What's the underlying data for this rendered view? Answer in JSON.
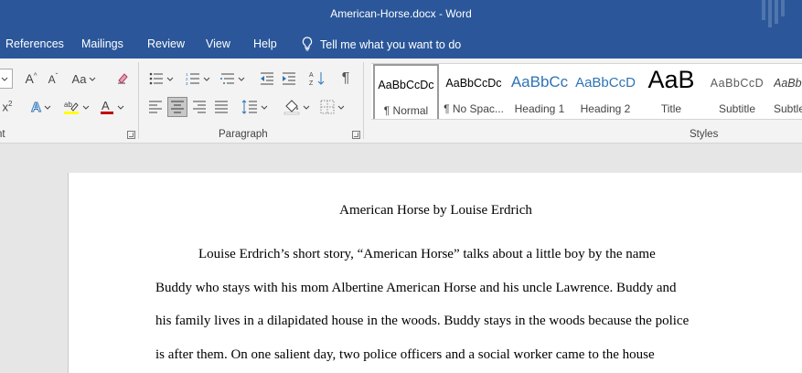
{
  "titlebar": {
    "title": "American-Horse.docx  -  Word"
  },
  "menu": {
    "tabs": [
      "References",
      "Mailings",
      "Review",
      "View",
      "Help"
    ],
    "tell_me": "Tell me what you want to do"
  },
  "ribbon": {
    "font_group_label": "nt",
    "paragraph_group_label": "Paragraph",
    "styles_group_label": "Styles",
    "change_case_label": "Aa",
    "styles": [
      {
        "preview": "AaBbCcDc",
        "name": "¶ Normal",
        "color": "#000000"
      },
      {
        "preview": "AaBbCcDc",
        "name": "¶ No Spac...",
        "color": "#000000"
      },
      {
        "preview": "AaBbCc",
        "name": "Heading 1",
        "color": "#2e74b5"
      },
      {
        "preview": "AaBbCcD",
        "name": "Heading 2",
        "color": "#2e74b5"
      },
      {
        "preview": "AaB",
        "name": "Title",
        "color": "#000000"
      },
      {
        "preview": "AaBbCcD",
        "name": "Subtitle",
        "color": "#5a5a5a"
      },
      {
        "preview": "AaBbCcL",
        "name": "Subtle",
        "color": "#404040"
      }
    ]
  },
  "document": {
    "title": "American Horse by Louise Erdrich",
    "lines": [
      "Louise Erdrich’s short story, “American Horse” talks about a little boy by the name",
      "Buddy who stays with his mom Albertine American Horse and his uncle Lawrence. Buddy and",
      "his family lives in a dilapidated house in the woods. Buddy stays in the woods because the police",
      "is after them. On one salient day, two police officers and a social worker came to the house"
    ]
  },
  "colors": {
    "word_blue": "#2b579a",
    "ribbon_bg": "#f3f3f3",
    "canvas_bg": "#e6e6e6"
  }
}
